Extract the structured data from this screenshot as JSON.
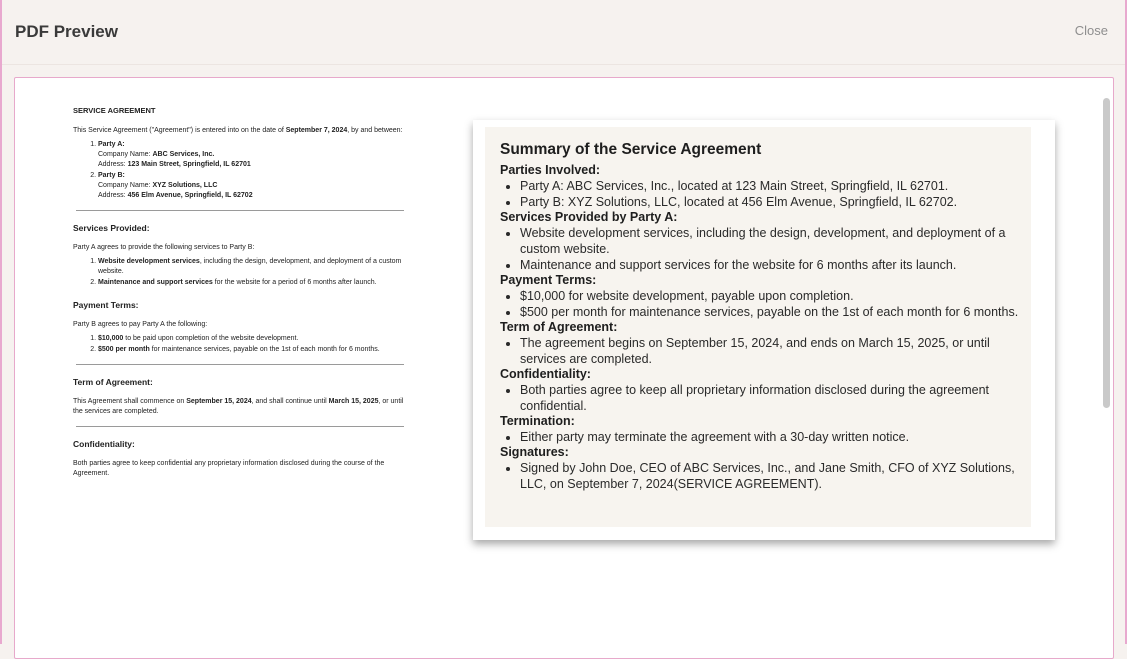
{
  "modal": {
    "title": "PDF Preview",
    "close_label": "Close"
  },
  "document": {
    "title": "SERVICE AGREEMENT",
    "intro_pre": "This Service Agreement (\"Agreement\") is entered into on the date of ",
    "intro_date": "September 7, 2024",
    "intro_post": ", by and between:",
    "parties": [
      {
        "label": "Party A:",
        "company_prefix": "Company Name: ",
        "company": "ABC Services, Inc.",
        "address_prefix": "Address: ",
        "address": "123 Main Street, Springfield, IL 62701"
      },
      {
        "label": "Party B:",
        "company_prefix": "Company Name: ",
        "company": "XYZ Solutions, LLC",
        "address_prefix": "Address: ",
        "address": "456 Elm Avenue, Springfield, IL 62702"
      }
    ],
    "services": {
      "heading": "Services Provided:",
      "intro": "Party A agrees to provide the following services to Party B:",
      "items": [
        {
          "bold": "Website development services",
          "rest": ", including the design, development, and deployment of a custom website."
        },
        {
          "bold": "Maintenance and support services",
          "rest": " for the website for a period of 6 months after launch."
        }
      ]
    },
    "payment": {
      "heading": "Payment Terms:",
      "intro": "Party B agrees to pay Party A the following:",
      "items": [
        {
          "bold": "$10,000",
          "rest": " to be paid upon completion of the website development."
        },
        {
          "bold": "$500 per month",
          "rest": " for maintenance services, payable on the 1st of each month for 6 months."
        }
      ]
    },
    "term": {
      "heading": "Term of Agreement:",
      "pre": "This Agreement shall commence on ",
      "start": "September 15, 2024",
      "mid": ", and shall continue until ",
      "end": "March 15, 2025",
      "post": ", or until the services are completed."
    },
    "confidentiality": {
      "heading": "Confidentiality:",
      "text": "Both parties agree to keep confidential any proprietary information disclosed during the course of the Agreement."
    }
  },
  "summary": {
    "title": "Summary of the Service Agreement",
    "sections": [
      {
        "heading": "Parties Involved:",
        "items": [
          "Party A: ABC Services, Inc., located at 123 Main Street, Springfield, IL 62701.",
          "Party B: XYZ Solutions, LLC, located at 456 Elm Avenue, Springfield, IL 62702."
        ]
      },
      {
        "heading": "Services Provided by Party A:",
        "items": [
          "Website development services, including the design, development, and deployment of a custom website.",
          "Maintenance and support services for the website for 6 months after its launch."
        ]
      },
      {
        "heading": "Payment Terms:",
        "items": [
          "$10,000 for website development, payable upon completion.",
          "$500 per month for maintenance services, payable on the 1st of each month for 6 months."
        ]
      },
      {
        "heading": "Term of Agreement:",
        "items": [
          "The agreement begins on September 15, 2024, and ends on March 15, 2025, or until services are completed."
        ]
      },
      {
        "heading": "Confidentiality:",
        "items": [
          "Both parties agree to keep all proprietary information disclosed during the agreement confidential."
        ]
      },
      {
        "heading": "Termination:",
        "items": [
          "Either party may terminate the agreement with a 30-day written notice."
        ]
      },
      {
        "heading": "Signatures:",
        "items": [
          "Signed by John Doe, CEO of ABC Services, Inc., and Jane Smith, CFO of XYZ Solutions, LLC, on September 7, 2024(SERVICE AGREEMENT)."
        ]
      }
    ]
  }
}
